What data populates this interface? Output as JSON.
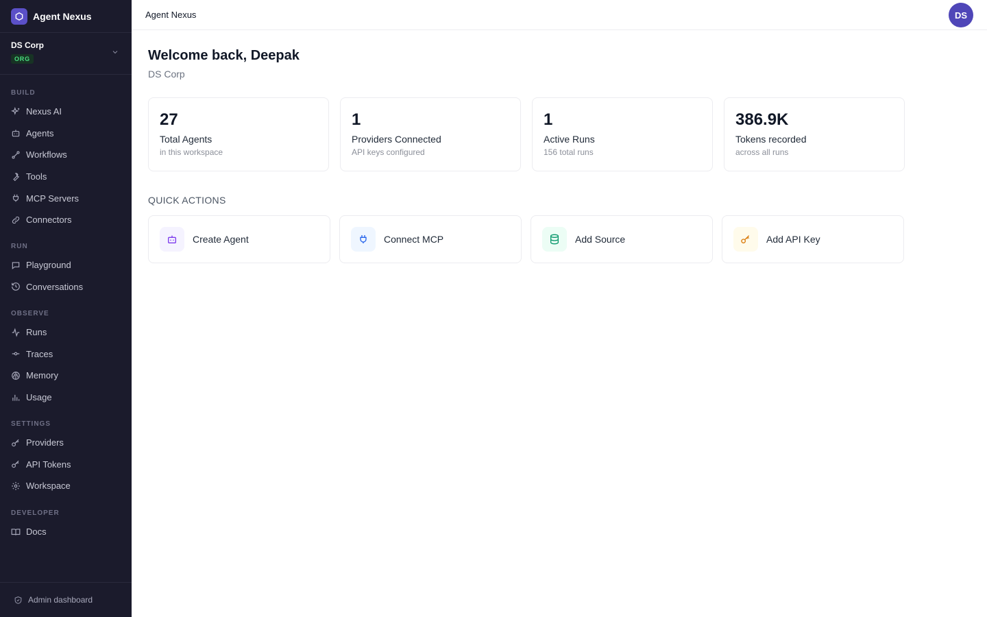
{
  "app": {
    "name": "Agent Nexus"
  },
  "org": {
    "name": "DS Corp",
    "badge": "ORG"
  },
  "sidebar": {
    "sections": [
      {
        "title": "BUILD",
        "items": [
          {
            "label": "Nexus AI",
            "icon": "sparkles-icon"
          },
          {
            "label": "Agents",
            "icon": "robot-icon"
          },
          {
            "label": "Workflows",
            "icon": "workflow-icon"
          },
          {
            "label": "Tools",
            "icon": "wrench-icon"
          },
          {
            "label": "MCP Servers",
            "icon": "plug-icon"
          },
          {
            "label": "Connectors",
            "icon": "link-icon"
          }
        ]
      },
      {
        "title": "RUN",
        "items": [
          {
            "label": "Playground",
            "icon": "chat-icon"
          },
          {
            "label": "Conversations",
            "icon": "history-icon"
          }
        ]
      },
      {
        "title": "OBSERVE",
        "items": [
          {
            "label": "Runs",
            "icon": "activity-icon"
          },
          {
            "label": "Traces",
            "icon": "commit-icon"
          },
          {
            "label": "Memory",
            "icon": "brain-icon"
          },
          {
            "label": "Usage",
            "icon": "bar-chart-icon"
          }
        ]
      },
      {
        "title": "SETTINGS",
        "items": [
          {
            "label": "Providers",
            "icon": "key-icon"
          },
          {
            "label": "API Tokens",
            "icon": "key-icon"
          },
          {
            "label": "Workspace",
            "icon": "gear-icon"
          }
        ]
      },
      {
        "title": "DEVELOPER",
        "items": [
          {
            "label": "Docs",
            "icon": "book-icon"
          }
        ]
      }
    ],
    "admin_label": "Admin dashboard"
  },
  "topbar": {
    "title": "Agent Nexus",
    "avatar_initials": "DS"
  },
  "main": {
    "welcome": "Welcome back, Deepak",
    "subtitle": "DS Corp",
    "stats": [
      {
        "value": "27",
        "label": "Total Agents",
        "sub": "in this workspace"
      },
      {
        "value": "1",
        "label": "Providers Connected",
        "sub": "API keys configured"
      },
      {
        "value": "1",
        "label": "Active Runs",
        "sub": "156 total runs"
      },
      {
        "value": "386.9K",
        "label": "Tokens recorded",
        "sub": "across all runs"
      }
    ],
    "quick_actions_title": "QUICK ACTIONS",
    "quick_actions": [
      {
        "label": "Create Agent",
        "icon": "robot-icon",
        "color": "#7c3aed",
        "bg": "#f5f3ff"
      },
      {
        "label": "Connect MCP",
        "icon": "plug-icon",
        "color": "#2563eb",
        "bg": "#eff6ff"
      },
      {
        "label": "Add Source",
        "icon": "database-icon",
        "color": "#059669",
        "bg": "#ecfdf5"
      },
      {
        "label": "Add API Key",
        "icon": "key-icon",
        "color": "#d97706",
        "bg": "#fffbeb"
      }
    ]
  },
  "colors": {
    "sidebar_bg": "#1b1b2c",
    "brand_accent": "#5b50c8",
    "org_badge": "#4ade80",
    "avatar_bg": "#4f46b8"
  }
}
